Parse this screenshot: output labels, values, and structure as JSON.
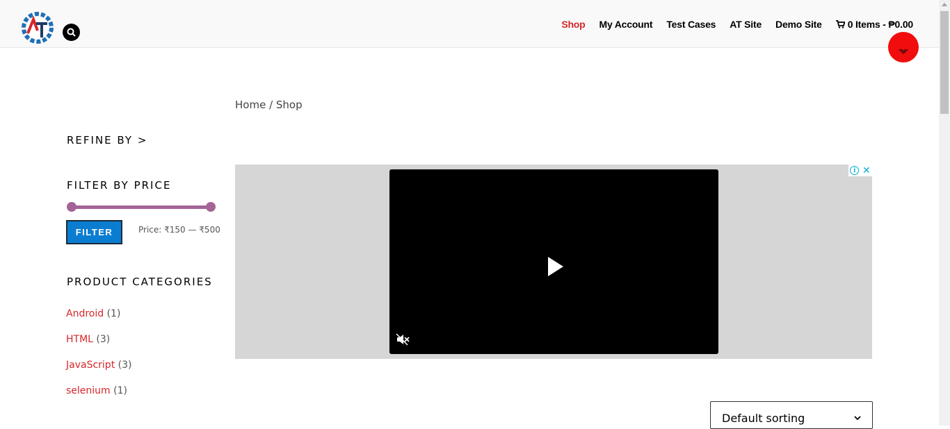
{
  "header": {
    "nav": [
      "Shop",
      "My Account",
      "Test Cases",
      "AT Site",
      "Demo Site"
    ],
    "cart_label": "0 Items - ₱0.00"
  },
  "breadcrumb": {
    "home": "Home",
    "separator": " / ",
    "current": "Shop"
  },
  "sidebar": {
    "refine_by": "REFINE BY >",
    "filter_heading": "FILTER BY PRICE",
    "filter_button": "FILTER",
    "price_label": "Price: ₹150 — ₹500",
    "price_min": 150,
    "price_max": 500,
    "categories_heading": "PRODUCT CATEGORIES",
    "categories": [
      {
        "name": "Android",
        "count": "(1)"
      },
      {
        "name": "HTML",
        "count": "(3)"
      },
      {
        "name": "JavaScript",
        "count": "(3)"
      },
      {
        "name": "selenium",
        "count": "(1)"
      }
    ]
  },
  "sorting": {
    "selected": "Default sorting"
  },
  "colors": {
    "accent": "#d6262a",
    "filter_button": "#0b7dd1",
    "slider": "#a46497",
    "scroll_top": "#f10d0d"
  }
}
